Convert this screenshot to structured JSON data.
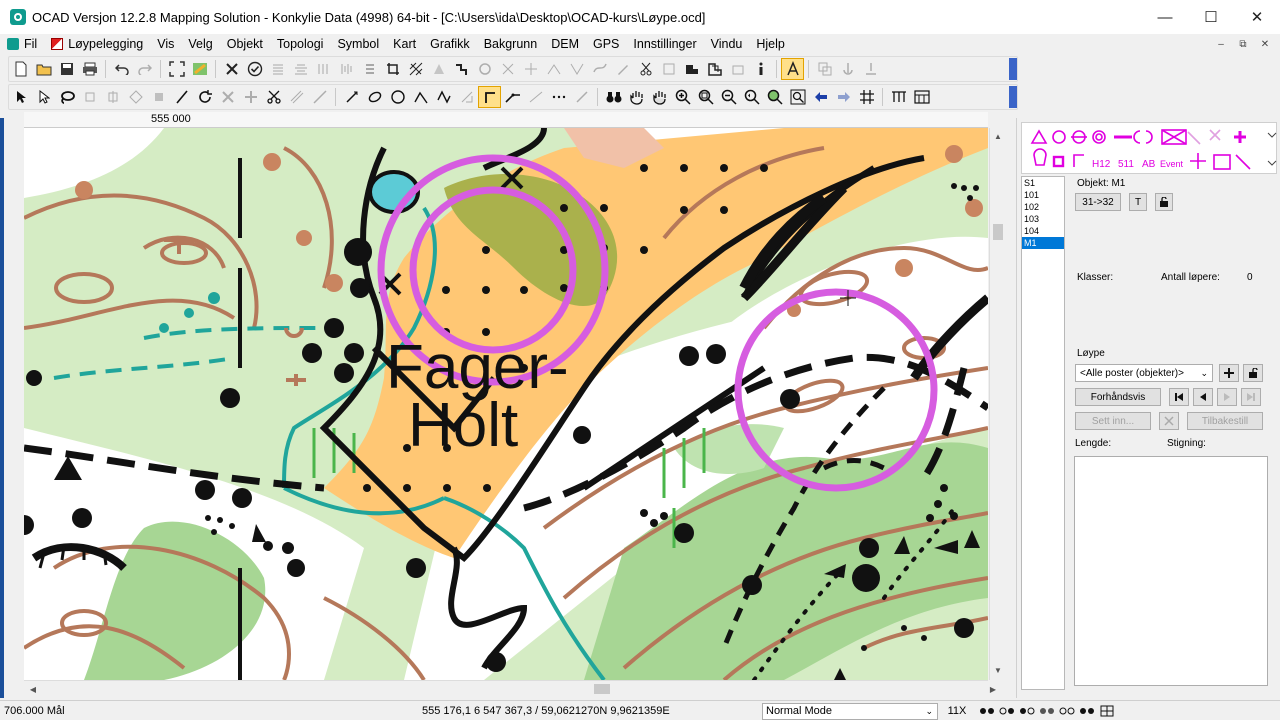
{
  "window": {
    "title": "OCAD Versjon 12.2.8  Mapping Solution - Konkylie Data (4998) 64-bit - [C:\\Users\\ida\\Desktop\\OCAD-kurs\\Løype.ocd]",
    "minimize": "—",
    "maximize": "☐",
    "close": "✕"
  },
  "menu": {
    "items": [
      "Fil",
      "Løypelegging",
      "Vis",
      "Velg",
      "Objekt",
      "Topologi",
      "Symbol",
      "Kart",
      "Grafikk",
      "Bakgrunn",
      "DEM",
      "GPS",
      "Innstillinger",
      "Vindu",
      "Hjelp"
    ],
    "mdi": [
      "–",
      "⧉",
      "✕"
    ]
  },
  "ruler": {
    "label": "555 000"
  },
  "map": {
    "place_name_line1": "Fager-",
    "place_name_line2": "Holt",
    "colors": {
      "open_green": "#d5ecc4",
      "green_dark": "#9fd18d",
      "yellow": "#ffc774",
      "contour": "#b5785a",
      "purple": "#d65de0",
      "teal": "#20a59b",
      "olive": "#aab14c"
    }
  },
  "right_panel": {
    "courses": [
      "S1",
      "101",
      "102",
      "103",
      "104",
      "M1"
    ],
    "selected_course": "M1",
    "object_label": "Objekt: M1",
    "code_button": "31->32",
    "t_button": "T",
    "klasser_label": "Klasser:",
    "antall_label": "Antall løpere:",
    "antall_value": "0",
    "loype_label": "Løype",
    "loype_select": "<Alle poster (objekter)>",
    "preview_button": "Forhåndsvis",
    "sett_inn_button": "Sett inn...",
    "tilbakestill_button": "Tilbakestill",
    "lengde_label": "Lengde:",
    "stigning_label": "Stigning:",
    "palette_text": [
      "H12",
      "511",
      "AB",
      "Event"
    ]
  },
  "status": {
    "scale": "706.000 Mål",
    "coordinates": "555 176,1   6 547 367,3  /  59,0621270N  9,9621359E",
    "mode": "Normal Mode",
    "zoom": "11X"
  }
}
